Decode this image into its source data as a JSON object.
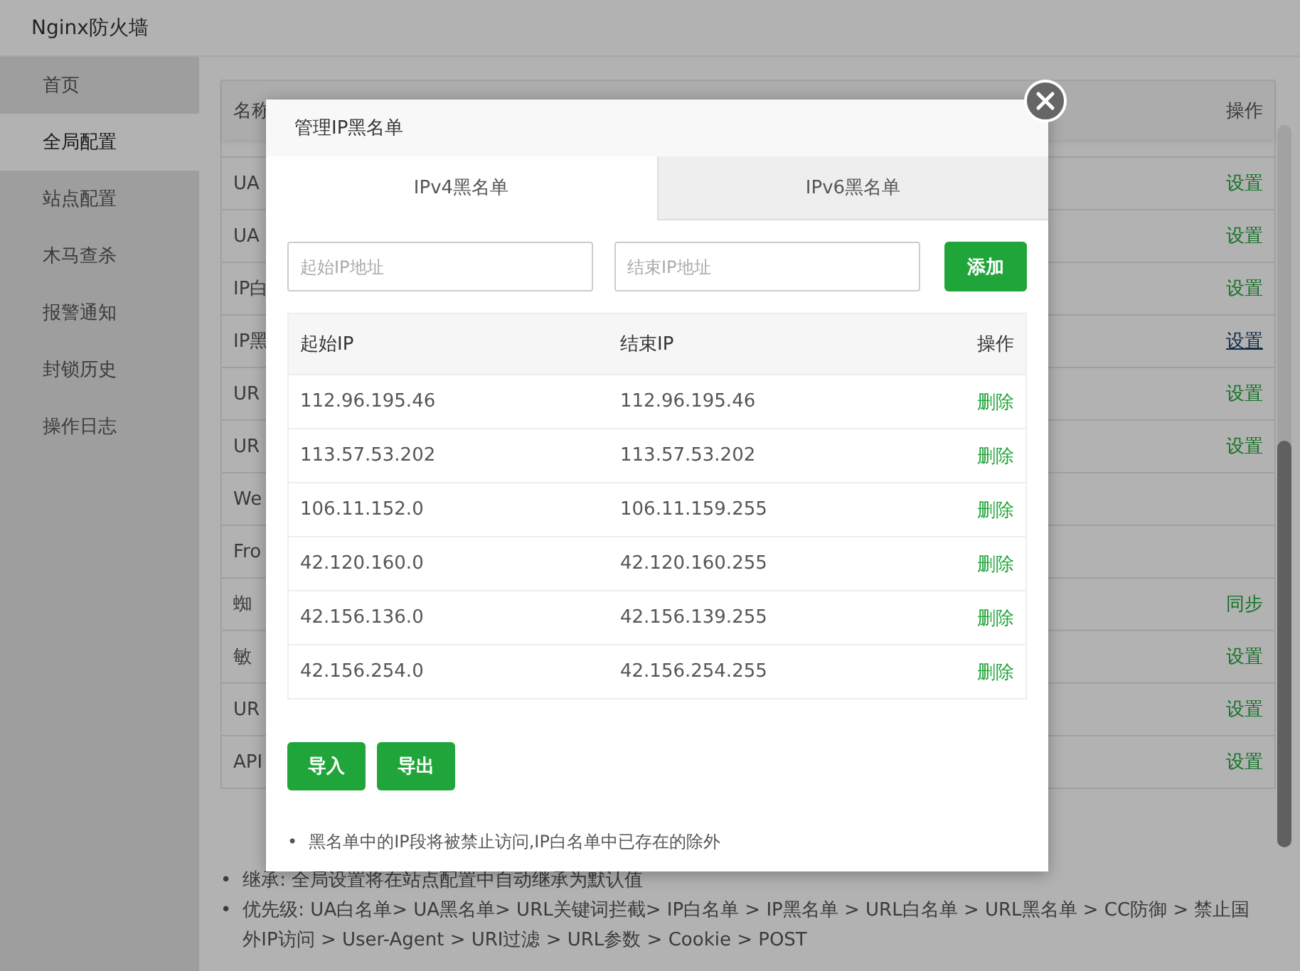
{
  "app": {
    "title": "Nginx防火墙"
  },
  "sidebar": {
    "items": [
      {
        "label": "首页",
        "selected": false
      },
      {
        "label": "全局配置",
        "selected": true
      },
      {
        "label": "站点配置",
        "selected": false
      },
      {
        "label": "木马查杀",
        "selected": false
      },
      {
        "label": "报警通知",
        "selected": false
      },
      {
        "label": "封锁历史",
        "selected": false
      },
      {
        "label": "操作日志",
        "selected": false
      }
    ]
  },
  "table": {
    "columns": [
      "名称",
      "操作"
    ],
    "rows": [
      {
        "name": "UA",
        "action": "设置",
        "hover": false
      },
      {
        "name": "UA",
        "action": "设置",
        "hover": false
      },
      {
        "name": "IP白",
        "action": "设置",
        "hover": false
      },
      {
        "name": "IP黑",
        "action": "设置",
        "hover": true
      },
      {
        "name": "UR",
        "action": "设置",
        "hover": false
      },
      {
        "name": "UR",
        "action": "设置",
        "hover": false
      },
      {
        "name": "We"
      },
      {
        "name": "Fro"
      },
      {
        "name": "蜘",
        "action": "同步",
        "hover": false
      },
      {
        "name": "敏",
        "action": "设置",
        "hover": false
      },
      {
        "name": "UR",
        "action": "设置",
        "hover": false
      },
      {
        "name": "API",
        "action": "设置",
        "hover": false
      }
    ]
  },
  "notes": [
    {
      "bullet": "•",
      "text": "继承: 全局设置将在站点配置中自动继承为默认值"
    },
    {
      "bullet": "•",
      "text": "优先级: UA白名单> UA黑名单> URL关键词拦截> IP白名单 > IP黑名单 > URL白名单 > URL黑名单 > CC防御 > 禁止国外IP访问 > User-Agent > URI过滤 > URL参数 > Cookie > POST"
    }
  ],
  "modal": {
    "title": "管理IP黑名单",
    "tabs": [
      {
        "label": "IPv4黑名单",
        "selected": true
      },
      {
        "label": "IPv6黑名单",
        "selected": false
      }
    ],
    "start_field": {
      "placeholder": "起始IP地址"
    },
    "end_field": {
      "placeholder": "结束IP地址"
    },
    "add_button": "添加",
    "table": {
      "columns": [
        "起始IP",
        "结束IP",
        "操作"
      ],
      "rows": [
        {
          "start": "112.96.195.46",
          "end": "112.96.195.46",
          "action": "删除"
        },
        {
          "start": "113.57.53.202",
          "end": "113.57.53.202",
          "action": "删除"
        },
        {
          "start": "106.11.152.0",
          "end": "106.11.159.255",
          "action": "删除"
        },
        {
          "start": "42.120.160.0",
          "end": "42.120.160.255",
          "action": "删除"
        },
        {
          "start": "42.156.136.0",
          "end": "42.156.139.255",
          "action": "删除"
        },
        {
          "start": "42.156.254.0",
          "end": "42.156.254.255",
          "action": "删除"
        }
      ]
    },
    "buttons": [
      "导入",
      "导出"
    ],
    "notes": [
      {
        "bullet": "•",
        "text": "黑名单中的IP段将被禁止访问,IP白名单中已存在的除外"
      }
    ]
  }
}
